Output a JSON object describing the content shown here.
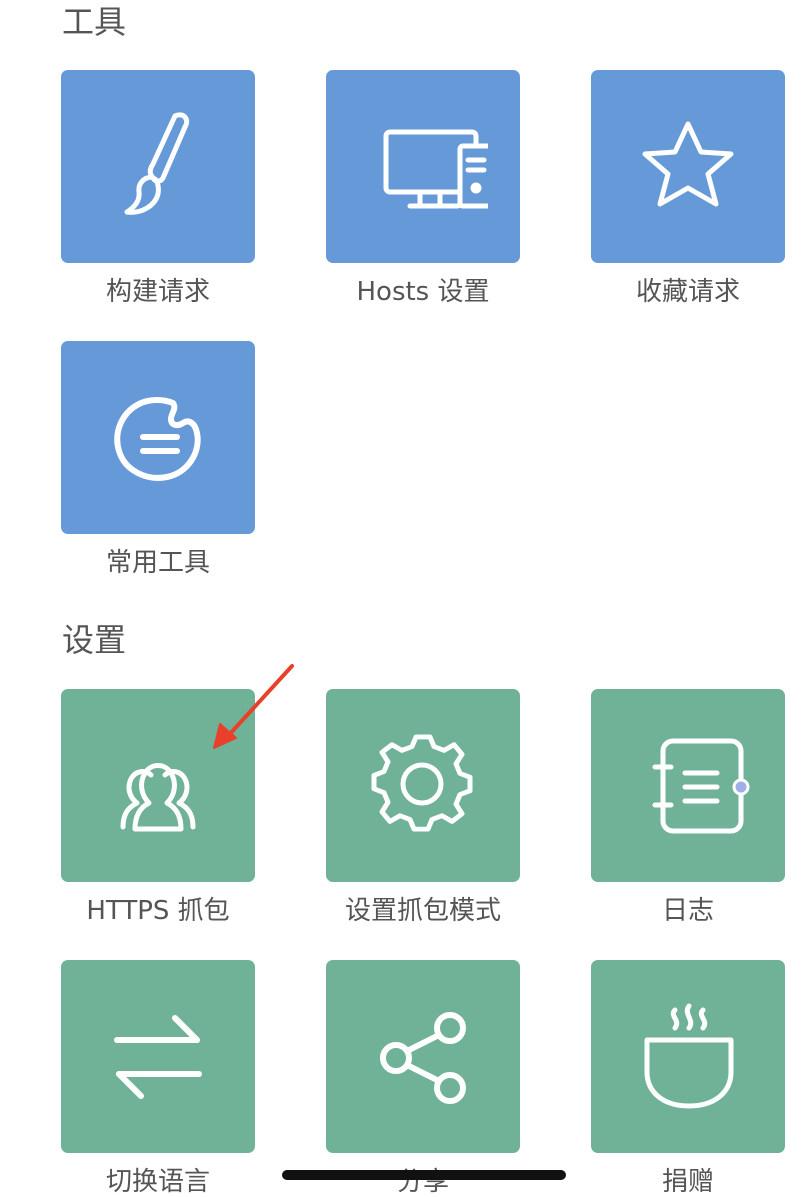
{
  "sections": {
    "tools": {
      "title": "工具",
      "items": [
        {
          "label": "构建请求",
          "icon": "brush-icon",
          "color": "#6699d8"
        },
        {
          "label": "Hosts 设置",
          "icon": "computer-icon",
          "color": "#6699d8"
        },
        {
          "label": "收藏请求",
          "icon": "star-icon",
          "color": "#6699d8"
        },
        {
          "label": "常用工具",
          "icon": "toolbox-bubble-icon",
          "color": "#6699d8"
        }
      ]
    },
    "settings": {
      "title": "设置",
      "items": [
        {
          "label": "HTTPS 抓包",
          "icon": "users-icon",
          "color": "#6fb298"
        },
        {
          "label": "设置抓包模式",
          "icon": "gear-icon",
          "color": "#6fb298"
        },
        {
          "label": "日志",
          "icon": "notebook-icon",
          "color": "#6fb298"
        },
        {
          "label": "切换语言",
          "icon": "swap-arrows-icon",
          "color": "#6fb298"
        },
        {
          "label": "分享",
          "icon": "share-icon",
          "color": "#6fb298"
        },
        {
          "label": "捐赠",
          "icon": "coffee-cup-icon",
          "color": "#6fb298"
        }
      ]
    }
  },
  "annotation": {
    "arrow_color": "#e8402a",
    "arrow_icon": "red-pointer-arrow-icon"
  }
}
